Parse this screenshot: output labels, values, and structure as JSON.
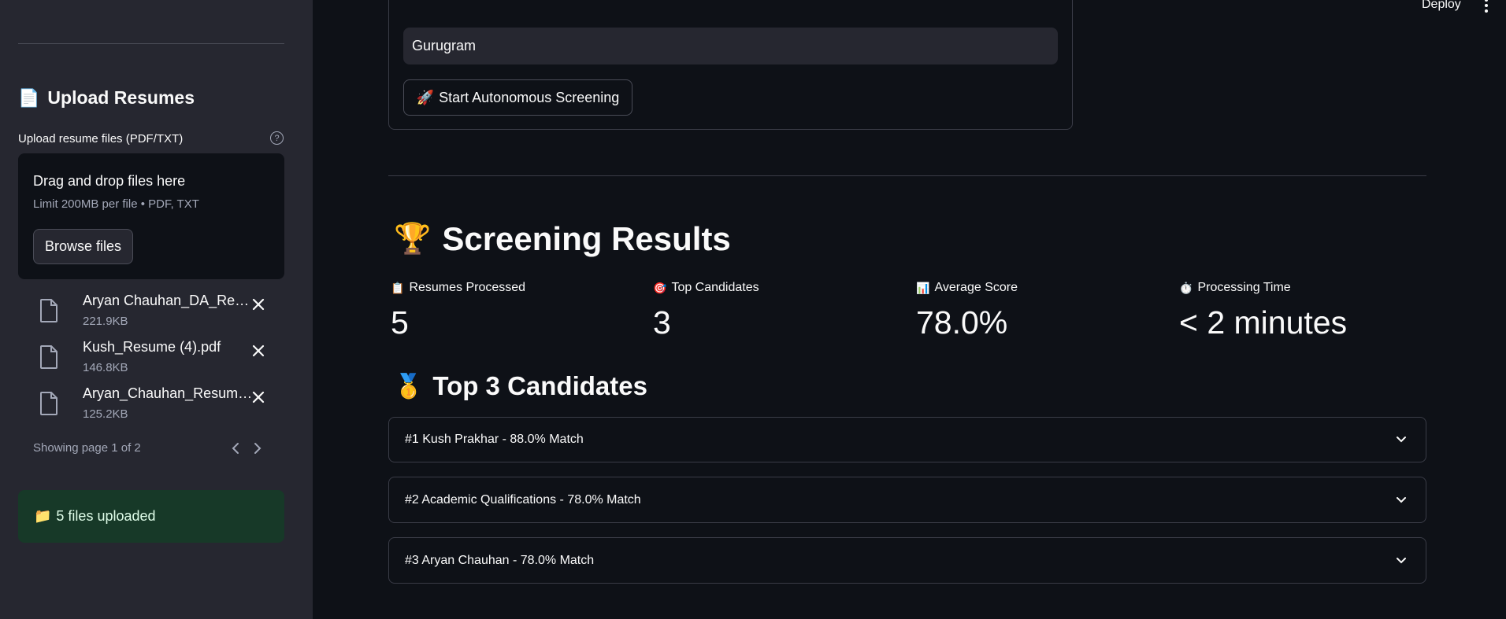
{
  "header": {
    "deploy_label": "Deploy",
    "menu_icon": "kebab-menu-icon"
  },
  "sidebar": {
    "upload_heading": {
      "emoji": "📄",
      "text": "Upload Resumes"
    },
    "upload_label": "Upload resume files (PDF/TXT)",
    "help_icon": "?",
    "dropzone": {
      "title": "Drag and drop files here",
      "limit": "Limit 200MB per file • PDF, TXT",
      "browse_label": "Browse files"
    },
    "files": [
      {
        "name": "Aryan Chauhan_DA_Resume.pdf",
        "size": "221.9KB"
      },
      {
        "name": "Kush_Resume (4).pdf",
        "size": "146.8KB"
      },
      {
        "name": "Aryan_Chauhan_Resume.pdf",
        "size": "125.2KB"
      }
    ],
    "pager": {
      "text": "Showing page 1 of 2"
    },
    "success": {
      "emoji": "📁",
      "text": "5 files uploaded"
    }
  },
  "form": {
    "location_value": "Gurugram",
    "start_button": {
      "emoji": "🚀",
      "text": "Start Autonomous Screening"
    }
  },
  "results": {
    "title": {
      "emoji": "🏆",
      "text": "Screening Results"
    },
    "metrics": [
      {
        "emoji": "📋",
        "label": "Resumes Processed",
        "value": "5"
      },
      {
        "emoji": "🎯",
        "label": "Top Candidates",
        "value": "3"
      },
      {
        "emoji": "📊",
        "label": "Average Score",
        "value": "78.0%"
      },
      {
        "emoji": "⏱️",
        "label": "Processing Time",
        "value": "< 2 minutes"
      }
    ],
    "top_title": {
      "emoji": "🥇",
      "text": "Top 3 Candidates"
    },
    "candidates": [
      {
        "label": "#1 Kush Prakhar - 88.0% Match"
      },
      {
        "label": "#2 Academic Qualifications - 78.0% Match"
      },
      {
        "label": "#3 Aryan Chauhan - 78.0% Match"
      }
    ]
  }
}
